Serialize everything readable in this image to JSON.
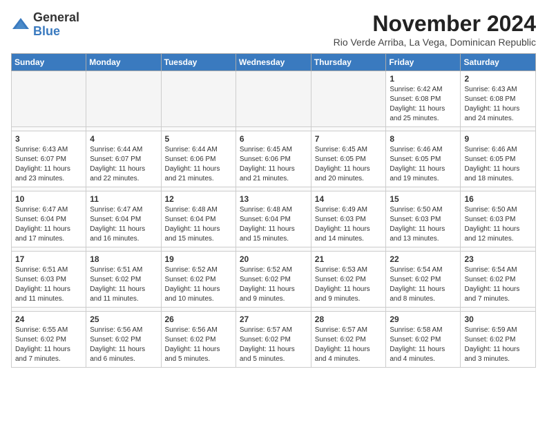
{
  "logo": {
    "general": "General",
    "blue": "Blue"
  },
  "header": {
    "month": "November 2024",
    "location": "Rio Verde Arriba, La Vega, Dominican Republic"
  },
  "weekdays": [
    "Sunday",
    "Monday",
    "Tuesday",
    "Wednesday",
    "Thursday",
    "Friday",
    "Saturday"
  ],
  "weeks": [
    [
      {
        "day": "",
        "info": ""
      },
      {
        "day": "",
        "info": ""
      },
      {
        "day": "",
        "info": ""
      },
      {
        "day": "",
        "info": ""
      },
      {
        "day": "",
        "info": ""
      },
      {
        "day": "1",
        "info": "Sunrise: 6:42 AM\nSunset: 6:08 PM\nDaylight: 11 hours and 25 minutes."
      },
      {
        "day": "2",
        "info": "Sunrise: 6:43 AM\nSunset: 6:08 PM\nDaylight: 11 hours and 24 minutes."
      }
    ],
    [
      {
        "day": "3",
        "info": "Sunrise: 6:43 AM\nSunset: 6:07 PM\nDaylight: 11 hours and 23 minutes."
      },
      {
        "day": "4",
        "info": "Sunrise: 6:44 AM\nSunset: 6:07 PM\nDaylight: 11 hours and 22 minutes."
      },
      {
        "day": "5",
        "info": "Sunrise: 6:44 AM\nSunset: 6:06 PM\nDaylight: 11 hours and 21 minutes."
      },
      {
        "day": "6",
        "info": "Sunrise: 6:45 AM\nSunset: 6:06 PM\nDaylight: 11 hours and 21 minutes."
      },
      {
        "day": "7",
        "info": "Sunrise: 6:45 AM\nSunset: 6:05 PM\nDaylight: 11 hours and 20 minutes."
      },
      {
        "day": "8",
        "info": "Sunrise: 6:46 AM\nSunset: 6:05 PM\nDaylight: 11 hours and 19 minutes."
      },
      {
        "day": "9",
        "info": "Sunrise: 6:46 AM\nSunset: 6:05 PM\nDaylight: 11 hours and 18 minutes."
      }
    ],
    [
      {
        "day": "10",
        "info": "Sunrise: 6:47 AM\nSunset: 6:04 PM\nDaylight: 11 hours and 17 minutes."
      },
      {
        "day": "11",
        "info": "Sunrise: 6:47 AM\nSunset: 6:04 PM\nDaylight: 11 hours and 16 minutes."
      },
      {
        "day": "12",
        "info": "Sunrise: 6:48 AM\nSunset: 6:04 PM\nDaylight: 11 hours and 15 minutes."
      },
      {
        "day": "13",
        "info": "Sunrise: 6:48 AM\nSunset: 6:04 PM\nDaylight: 11 hours and 15 minutes."
      },
      {
        "day": "14",
        "info": "Sunrise: 6:49 AM\nSunset: 6:03 PM\nDaylight: 11 hours and 14 minutes."
      },
      {
        "day": "15",
        "info": "Sunrise: 6:50 AM\nSunset: 6:03 PM\nDaylight: 11 hours and 13 minutes."
      },
      {
        "day": "16",
        "info": "Sunrise: 6:50 AM\nSunset: 6:03 PM\nDaylight: 11 hours and 12 minutes."
      }
    ],
    [
      {
        "day": "17",
        "info": "Sunrise: 6:51 AM\nSunset: 6:03 PM\nDaylight: 11 hours and 11 minutes."
      },
      {
        "day": "18",
        "info": "Sunrise: 6:51 AM\nSunset: 6:02 PM\nDaylight: 11 hours and 11 minutes."
      },
      {
        "day": "19",
        "info": "Sunrise: 6:52 AM\nSunset: 6:02 PM\nDaylight: 11 hours and 10 minutes."
      },
      {
        "day": "20",
        "info": "Sunrise: 6:52 AM\nSunset: 6:02 PM\nDaylight: 11 hours and 9 minutes."
      },
      {
        "day": "21",
        "info": "Sunrise: 6:53 AM\nSunset: 6:02 PM\nDaylight: 11 hours and 9 minutes."
      },
      {
        "day": "22",
        "info": "Sunrise: 6:54 AM\nSunset: 6:02 PM\nDaylight: 11 hours and 8 minutes."
      },
      {
        "day": "23",
        "info": "Sunrise: 6:54 AM\nSunset: 6:02 PM\nDaylight: 11 hours and 7 minutes."
      }
    ],
    [
      {
        "day": "24",
        "info": "Sunrise: 6:55 AM\nSunset: 6:02 PM\nDaylight: 11 hours and 7 minutes."
      },
      {
        "day": "25",
        "info": "Sunrise: 6:56 AM\nSunset: 6:02 PM\nDaylight: 11 hours and 6 minutes."
      },
      {
        "day": "26",
        "info": "Sunrise: 6:56 AM\nSunset: 6:02 PM\nDaylight: 11 hours and 5 minutes."
      },
      {
        "day": "27",
        "info": "Sunrise: 6:57 AM\nSunset: 6:02 PM\nDaylight: 11 hours and 5 minutes."
      },
      {
        "day": "28",
        "info": "Sunrise: 6:57 AM\nSunset: 6:02 PM\nDaylight: 11 hours and 4 minutes."
      },
      {
        "day": "29",
        "info": "Sunrise: 6:58 AM\nSunset: 6:02 PM\nDaylight: 11 hours and 4 minutes."
      },
      {
        "day": "30",
        "info": "Sunrise: 6:59 AM\nSunset: 6:02 PM\nDaylight: 11 hours and 3 minutes."
      }
    ]
  ]
}
